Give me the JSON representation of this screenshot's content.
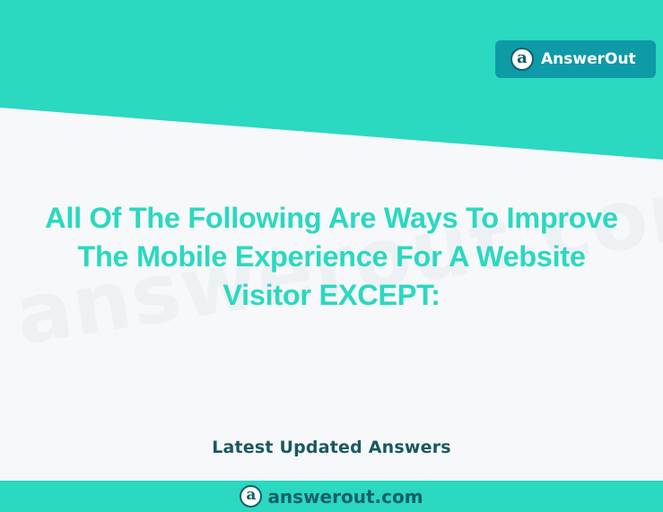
{
  "brand": {
    "name": "AnswerOut",
    "logo_glyph": "a",
    "icon": "answerout-logo-icon"
  },
  "watermark": {
    "text": "answerout.com"
  },
  "main": {
    "title_lines": [
      "All Of The Following Are Ways To Improve",
      "The Mobile Experience For A Website",
      "Visitor EXCEPT:"
    ],
    "subtitle": "Latest Updated Answers"
  },
  "footer": {
    "logo_glyph": "a",
    "url": "answerout.com",
    "icon": "answerout-logo-icon"
  },
  "colors": {
    "teal_accent": "#2bd8c0",
    "badge_bg": "#0e9aa7",
    "dark_teal": "#13606a",
    "subtitle": "#1b5860",
    "background": "#f6f8f9"
  }
}
